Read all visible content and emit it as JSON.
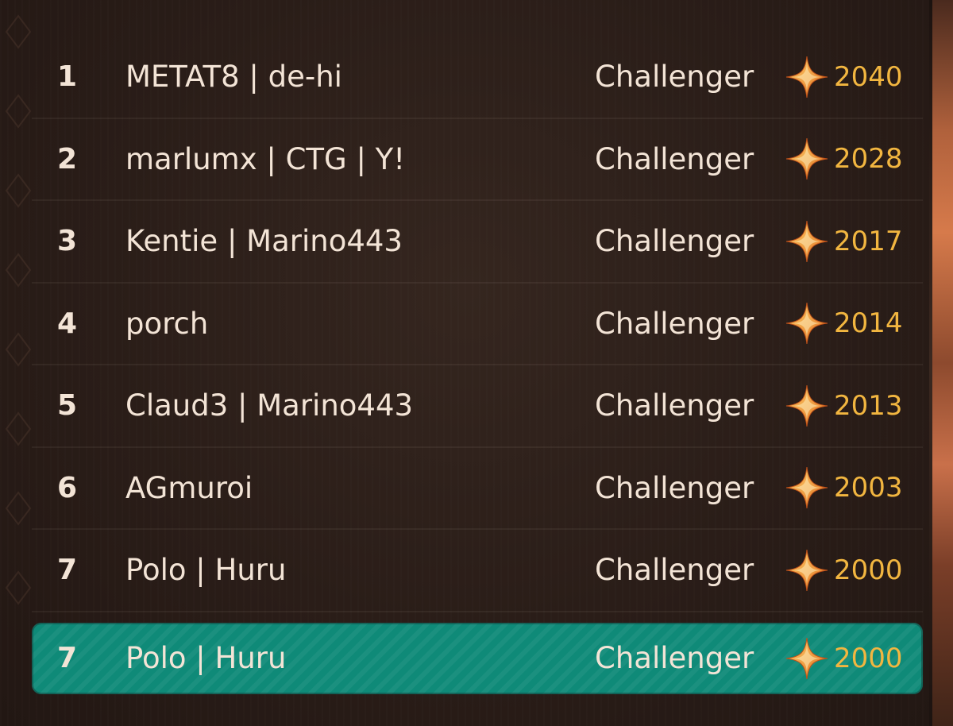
{
  "leaderboard": {
    "rows": [
      {
        "rank": "1",
        "name": "METAT8 | de-hi",
        "tier": "Challenger",
        "points": "2040"
      },
      {
        "rank": "2",
        "name": "marlumx | CTG | Y!",
        "tier": "Challenger",
        "points": "2028"
      },
      {
        "rank": "3",
        "name": "Kentie | Marino443",
        "tier": "Challenger",
        "points": "2017"
      },
      {
        "rank": "4",
        "name": "porch",
        "tier": "Challenger",
        "points": "2014"
      },
      {
        "rank": "5",
        "name": "Claud3 | Marino443",
        "tier": "Challenger",
        "points": "2013"
      },
      {
        "rank": "6",
        "name": "AGmuroi",
        "tier": "Challenger",
        "points": "2003"
      },
      {
        "rank": "7",
        "name": "Polo | Huru",
        "tier": "Challenger",
        "points": "2000"
      }
    ],
    "current_player": {
      "rank": "7",
      "name": "Polo | Huru",
      "tier": "Challenger",
      "points": "2000"
    }
  },
  "colors": {
    "background": "#2b1e1a",
    "text": "#f3e4d6",
    "points": "#f2b640",
    "highlight_row": "#0f8a78",
    "star_light": "#ffd06a",
    "star_dark": "#e0701f"
  },
  "icons": {
    "points": "four-point-star-icon"
  }
}
